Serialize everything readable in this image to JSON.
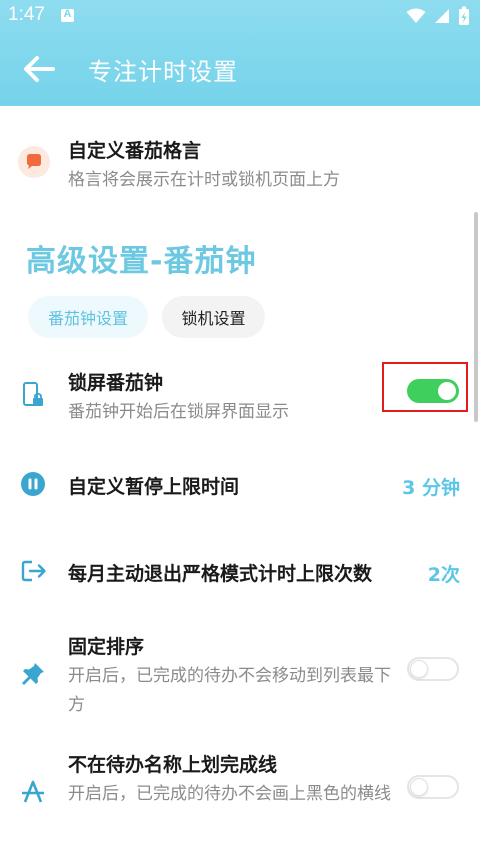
{
  "status": {
    "time": "1:47",
    "a_badge": "A"
  },
  "header": {
    "title": "专注计时设置"
  },
  "motto": {
    "title": "自定义番茄格言",
    "subtitle": "格言将会展示在计时或锁机页面上方"
  },
  "section": {
    "title": "高级设置-番茄钟",
    "tabs": [
      {
        "label": "番茄钟设置",
        "active": true
      },
      {
        "label": "锁机设置",
        "active": false
      }
    ]
  },
  "settings": {
    "lockscreen": {
      "title": "锁屏番茄钟",
      "subtitle": "番茄钟开始后在锁屏界面显示",
      "enabled": true
    },
    "pause_limit": {
      "title": "自定义暂停上限时间",
      "value": "3 分钟"
    },
    "exit_limit": {
      "title": "每月主动退出严格模式计时上限次数",
      "value": "2次"
    },
    "fixed_order": {
      "title": "固定排序",
      "subtitle": "开启后，已完成的待办不会移动到列表最下方",
      "enabled": false
    },
    "no_strike": {
      "title": "不在待办名称上划完成线",
      "subtitle": "开启后，已完成的待办不会画上黑色的横线",
      "enabled": false
    }
  },
  "colors": {
    "header": "#7fd7ec",
    "accent": "#5bc6e6",
    "toggle_on": "#3ecf5d",
    "highlight": "#e21b1b"
  }
}
